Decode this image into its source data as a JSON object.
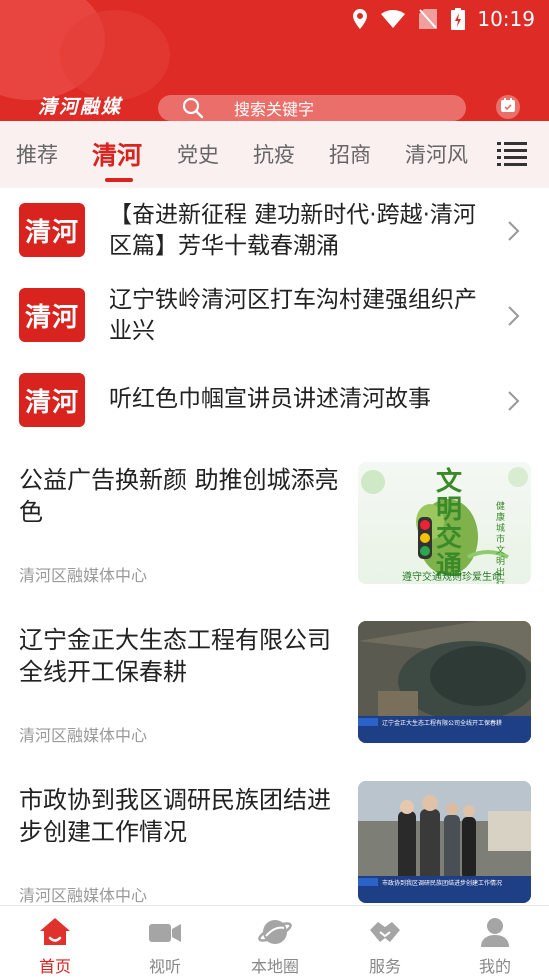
{
  "status_bar": {
    "time": "10:19"
  },
  "header": {
    "logo": "清河融媒",
    "search_placeholder": "搜索关键字"
  },
  "tabs": [
    {
      "label": "推荐",
      "active": false
    },
    {
      "label": "清河",
      "active": true
    },
    {
      "label": "党史",
      "active": false
    },
    {
      "label": "抗疫",
      "active": false
    },
    {
      "label": "招商",
      "active": false
    },
    {
      "label": "清河风",
      "active": false
    }
  ],
  "qinghe_items": [
    {
      "badge": "清河",
      "title": "【奋进新征程 建功新时代·跨越·清河区篇】芳华十载春潮涌"
    },
    {
      "badge": "清河",
      "title": "辽宁铁岭清河区打车沟村建强组织产业兴"
    },
    {
      "badge": "清河",
      "title": "听红色巾帼宣讲员讲述清河故事"
    }
  ],
  "news": [
    {
      "title": "公益广告换新颜 助推创城添亮色",
      "source": "清河区融媒体中心",
      "thumb": {
        "big_text": "文明交通",
        "side_text": "健康城市文明出行",
        "caption": "遵守交通规则珍爱生命"
      }
    },
    {
      "title": "辽宁金正大生态工程有限公司全线开工保春耕",
      "source": "清河区融媒体中心",
      "thumb": {
        "caption": "辽宁金正大生态工程有限公司全线开工保春耕"
      }
    },
    {
      "title": "市政协到我区调研民族团结进步创建工作情况",
      "source": "清河区融媒体中心",
      "thumb": {
        "caption": "市政协到我区调研民族团结进步创建工作情况"
      }
    }
  ],
  "bottom_nav": [
    {
      "label": "首页",
      "icon": "home-icon",
      "active": true
    },
    {
      "label": "视听",
      "icon": "video-camera-icon",
      "active": false
    },
    {
      "label": "本地圈",
      "icon": "planet-icon",
      "active": false
    },
    {
      "label": "服务",
      "icon": "handshake-icon",
      "active": false
    },
    {
      "label": "我的",
      "icon": "user-icon",
      "active": false
    }
  ],
  "colors": {
    "brand": "#de2b26",
    "accent": "#d8231f"
  }
}
